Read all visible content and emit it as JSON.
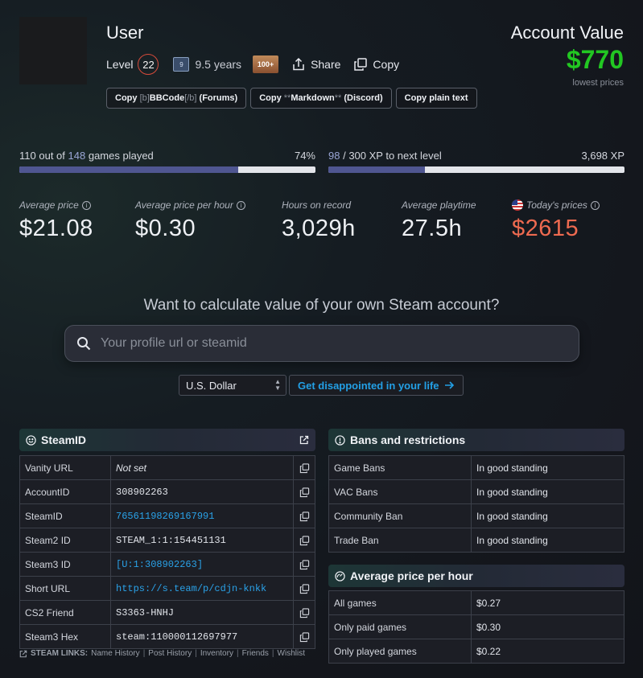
{
  "profile": {
    "name": "User",
    "level_label": "Level",
    "level": "22",
    "years_badge": "9",
    "years": "9.5 years",
    "badge_text": "100+",
    "share_label": "Share",
    "copy_label": "Copy"
  },
  "copy_buttons": {
    "forums": {
      "pre": "Copy",
      "code_open": "[b]",
      "mid": "BBCode",
      "code_close": "[/b]",
      "post": "(Forums)"
    },
    "discord": {
      "pre": "Copy",
      "code_open": "**",
      "mid": "Markdown",
      "code_close": "**",
      "post": "(Discord)"
    },
    "plain": "Copy plain text"
  },
  "account_value": {
    "title": "Account Value",
    "value": "$770",
    "subtitle": "lowest prices"
  },
  "progress": {
    "games": {
      "played": "110",
      "of": "out of",
      "total": "148",
      "suffix": "games played",
      "percent": "74%",
      "fill": 0.74
    },
    "xp": {
      "current": "98",
      "separator": "/ 300 XP to next level",
      "total": "3,698 XP",
      "fill": 0.3267
    }
  },
  "stats": {
    "avg_price": {
      "label": "Average price",
      "value": "$21.08"
    },
    "avg_price_hour": {
      "label": "Average price per hour",
      "value": "$0.30"
    },
    "hours": {
      "label": "Hours on record",
      "value": "3,029h"
    },
    "avg_playtime": {
      "label": "Average playtime",
      "value": "27.5h"
    },
    "today": {
      "label": "Today's prices",
      "value": "$2615"
    }
  },
  "calculator": {
    "question": "Want to calculate value of your own Steam account?",
    "placeholder": "Your profile url or steamid",
    "currency": "U.S. Dollar",
    "button": "Get disappointed in your life"
  },
  "steamid_panel": {
    "title": "SteamID",
    "rows": [
      {
        "label": "Vanity URL",
        "value": "Not set"
      },
      {
        "label": "AccountID",
        "value": "308902263"
      },
      {
        "label": "SteamID",
        "value": "76561198269167991"
      },
      {
        "label": "Steam2 ID",
        "value": "STEAM_1:1:154451131"
      },
      {
        "label": "Steam3 ID",
        "value": "[U:1:308902263]"
      },
      {
        "label": "Short URL",
        "value": "https://s.team/p/cdjn-knkk"
      },
      {
        "label": "CS2 Friend",
        "value": "S3363-HNHJ"
      },
      {
        "label": "Steam3 Hex",
        "value": "steam:110000112697977"
      }
    ]
  },
  "steam_links": {
    "lead": "STEAM LINKS:",
    "items": [
      "Name History",
      "Post History",
      "Inventory",
      "Friends",
      "Wishlist"
    ]
  },
  "bans_panel": {
    "title": "Bans and restrictions",
    "rows": [
      {
        "label": "Game Bans",
        "value": "In good standing"
      },
      {
        "label": "VAC Bans",
        "value": "In good standing"
      },
      {
        "label": "Community Ban",
        "value": "In good standing"
      },
      {
        "label": "Trade Ban",
        "value": "In good standing"
      }
    ]
  },
  "avg_hour_panel": {
    "title": "Average price per hour",
    "rows": [
      {
        "label": "All games",
        "value": "$0.27"
      },
      {
        "label": "Only paid games",
        "value": "$0.30"
      },
      {
        "label": "Only played games",
        "value": "$0.22"
      }
    ]
  },
  "colors": {
    "value_green": "#22c722",
    "today_red": "#ee6a50",
    "link_blue": "#2aa2e8",
    "bar_fill": "#4f5691"
  }
}
